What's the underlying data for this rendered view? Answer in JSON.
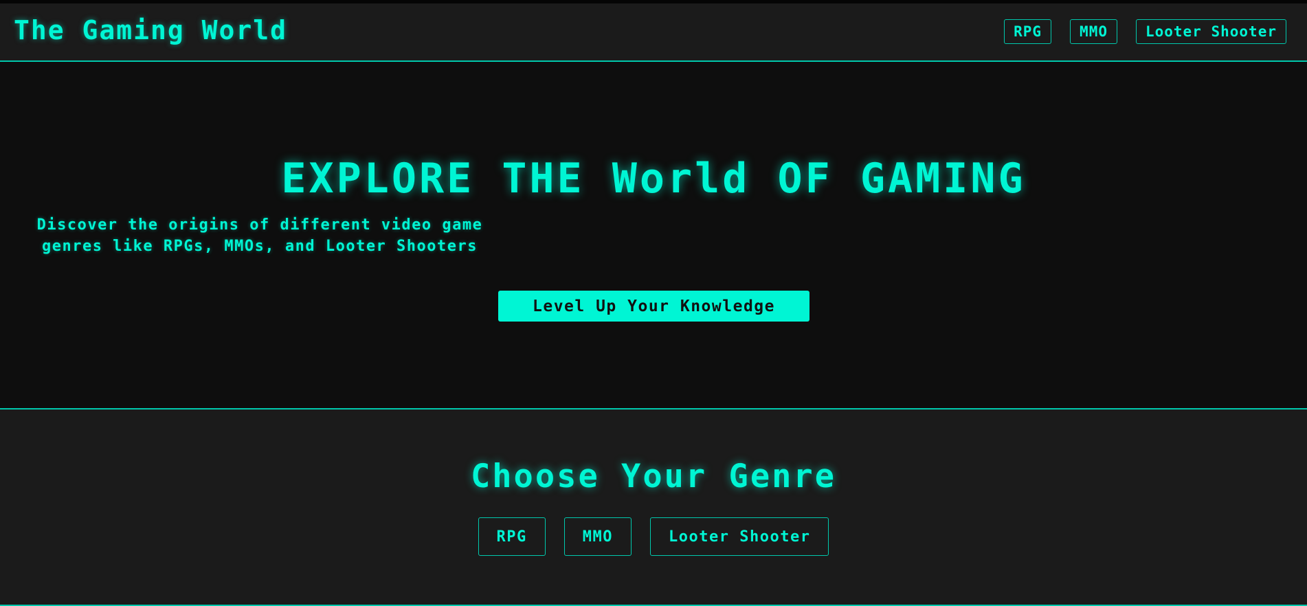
{
  "header": {
    "logo": "The Gaming World",
    "nav": [
      {
        "label": "RPG"
      },
      {
        "label": "MMO"
      },
      {
        "label": "Looter Shooter"
      }
    ]
  },
  "hero": {
    "title": "EXPLORE THE World OF GAMING",
    "description": "Discover the origins of different video game genres like RPGs, MMOs, and Looter Shooters",
    "cta_label": "Level Up Your Knowledge"
  },
  "genres": {
    "title": "Choose Your Genre",
    "buttons": [
      {
        "label": "RPG"
      },
      {
        "label": "MMO"
      },
      {
        "label": "Looter Shooter"
      }
    ]
  },
  "colors": {
    "accent": "#00f5d4",
    "background": "#0e0e0e",
    "panel": "#1b1b1b"
  }
}
